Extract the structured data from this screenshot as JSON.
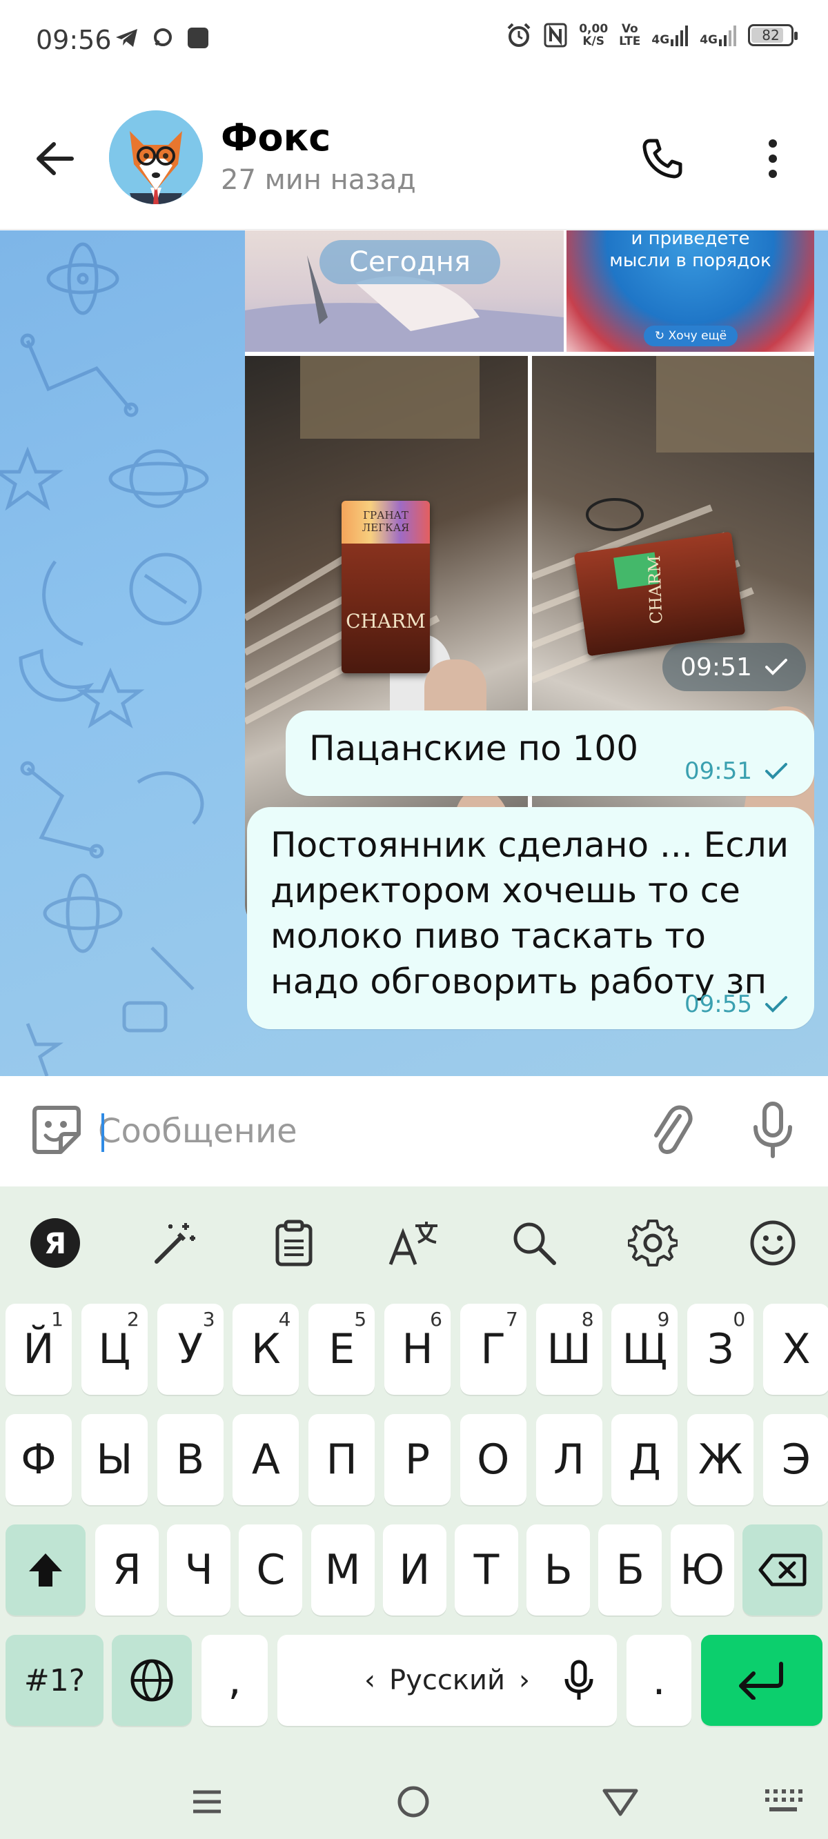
{
  "status_bar": {
    "time": "09:56",
    "speed_value": "0,00",
    "speed_unit": "K/S",
    "volte_top": "Vo",
    "volte_bottom": "LTE",
    "net1": "4G",
    "net2": "4G",
    "battery": "82"
  },
  "header": {
    "contact_name": "Фокс",
    "contact_status": "27 мин назад"
  },
  "chat": {
    "date_label": "Сегодня",
    "media_group": {
      "time": "09:51",
      "promo_text_line1": "и приведете",
      "promo_text_line2": "мысли в порядок",
      "promo_button": "Хочу ещё",
      "pack_brand": "CHARM",
      "pack_label": "ГРАНАТ ЛЕГКАЯ"
    },
    "messages": [
      {
        "text": "Пацанские по 100",
        "time": "09:51"
      },
      {
        "text": "Постоянник сделано ... Если директором хочешь то се молоко пиво таскать то надо обговорить работу зп",
        "time": "09:55"
      }
    ]
  },
  "composer": {
    "placeholder": "Сообщение"
  },
  "keyboard": {
    "row1": [
      {
        "label": "Й",
        "sup": "1"
      },
      {
        "label": "Ц",
        "sup": "2"
      },
      {
        "label": "У",
        "sup": "3"
      },
      {
        "label": "К",
        "sup": "4"
      },
      {
        "label": "Е",
        "sup": "5"
      },
      {
        "label": "Н",
        "sup": "6"
      },
      {
        "label": "Г",
        "sup": "7"
      },
      {
        "label": "Ш",
        "sup": "8"
      },
      {
        "label": "Щ",
        "sup": "9"
      },
      {
        "label": "З",
        "sup": "0"
      },
      {
        "label": "Х",
        "sup": ""
      }
    ],
    "row2": [
      "Ф",
      "Ы",
      "В",
      "А",
      "П",
      "Р",
      "О",
      "Л",
      "Д",
      "Ж",
      "Э"
    ],
    "row3": [
      "Я",
      "Ч",
      "С",
      "М",
      "И",
      "Т",
      "Ь",
      "Б",
      "Ю"
    ],
    "symbols_label": "#1?",
    "comma": ",",
    "period": ".",
    "space_label": "Русский",
    "ya_label": "Я"
  },
  "colors": {
    "bubble": "#eafdfb",
    "accent_blue": "#2f8be5",
    "enter_key": "#0ccf6d",
    "fn_key": "#bfe4d3",
    "keyboard_bg": "#e7f1e7",
    "meta_text": "#3aa0b0"
  }
}
